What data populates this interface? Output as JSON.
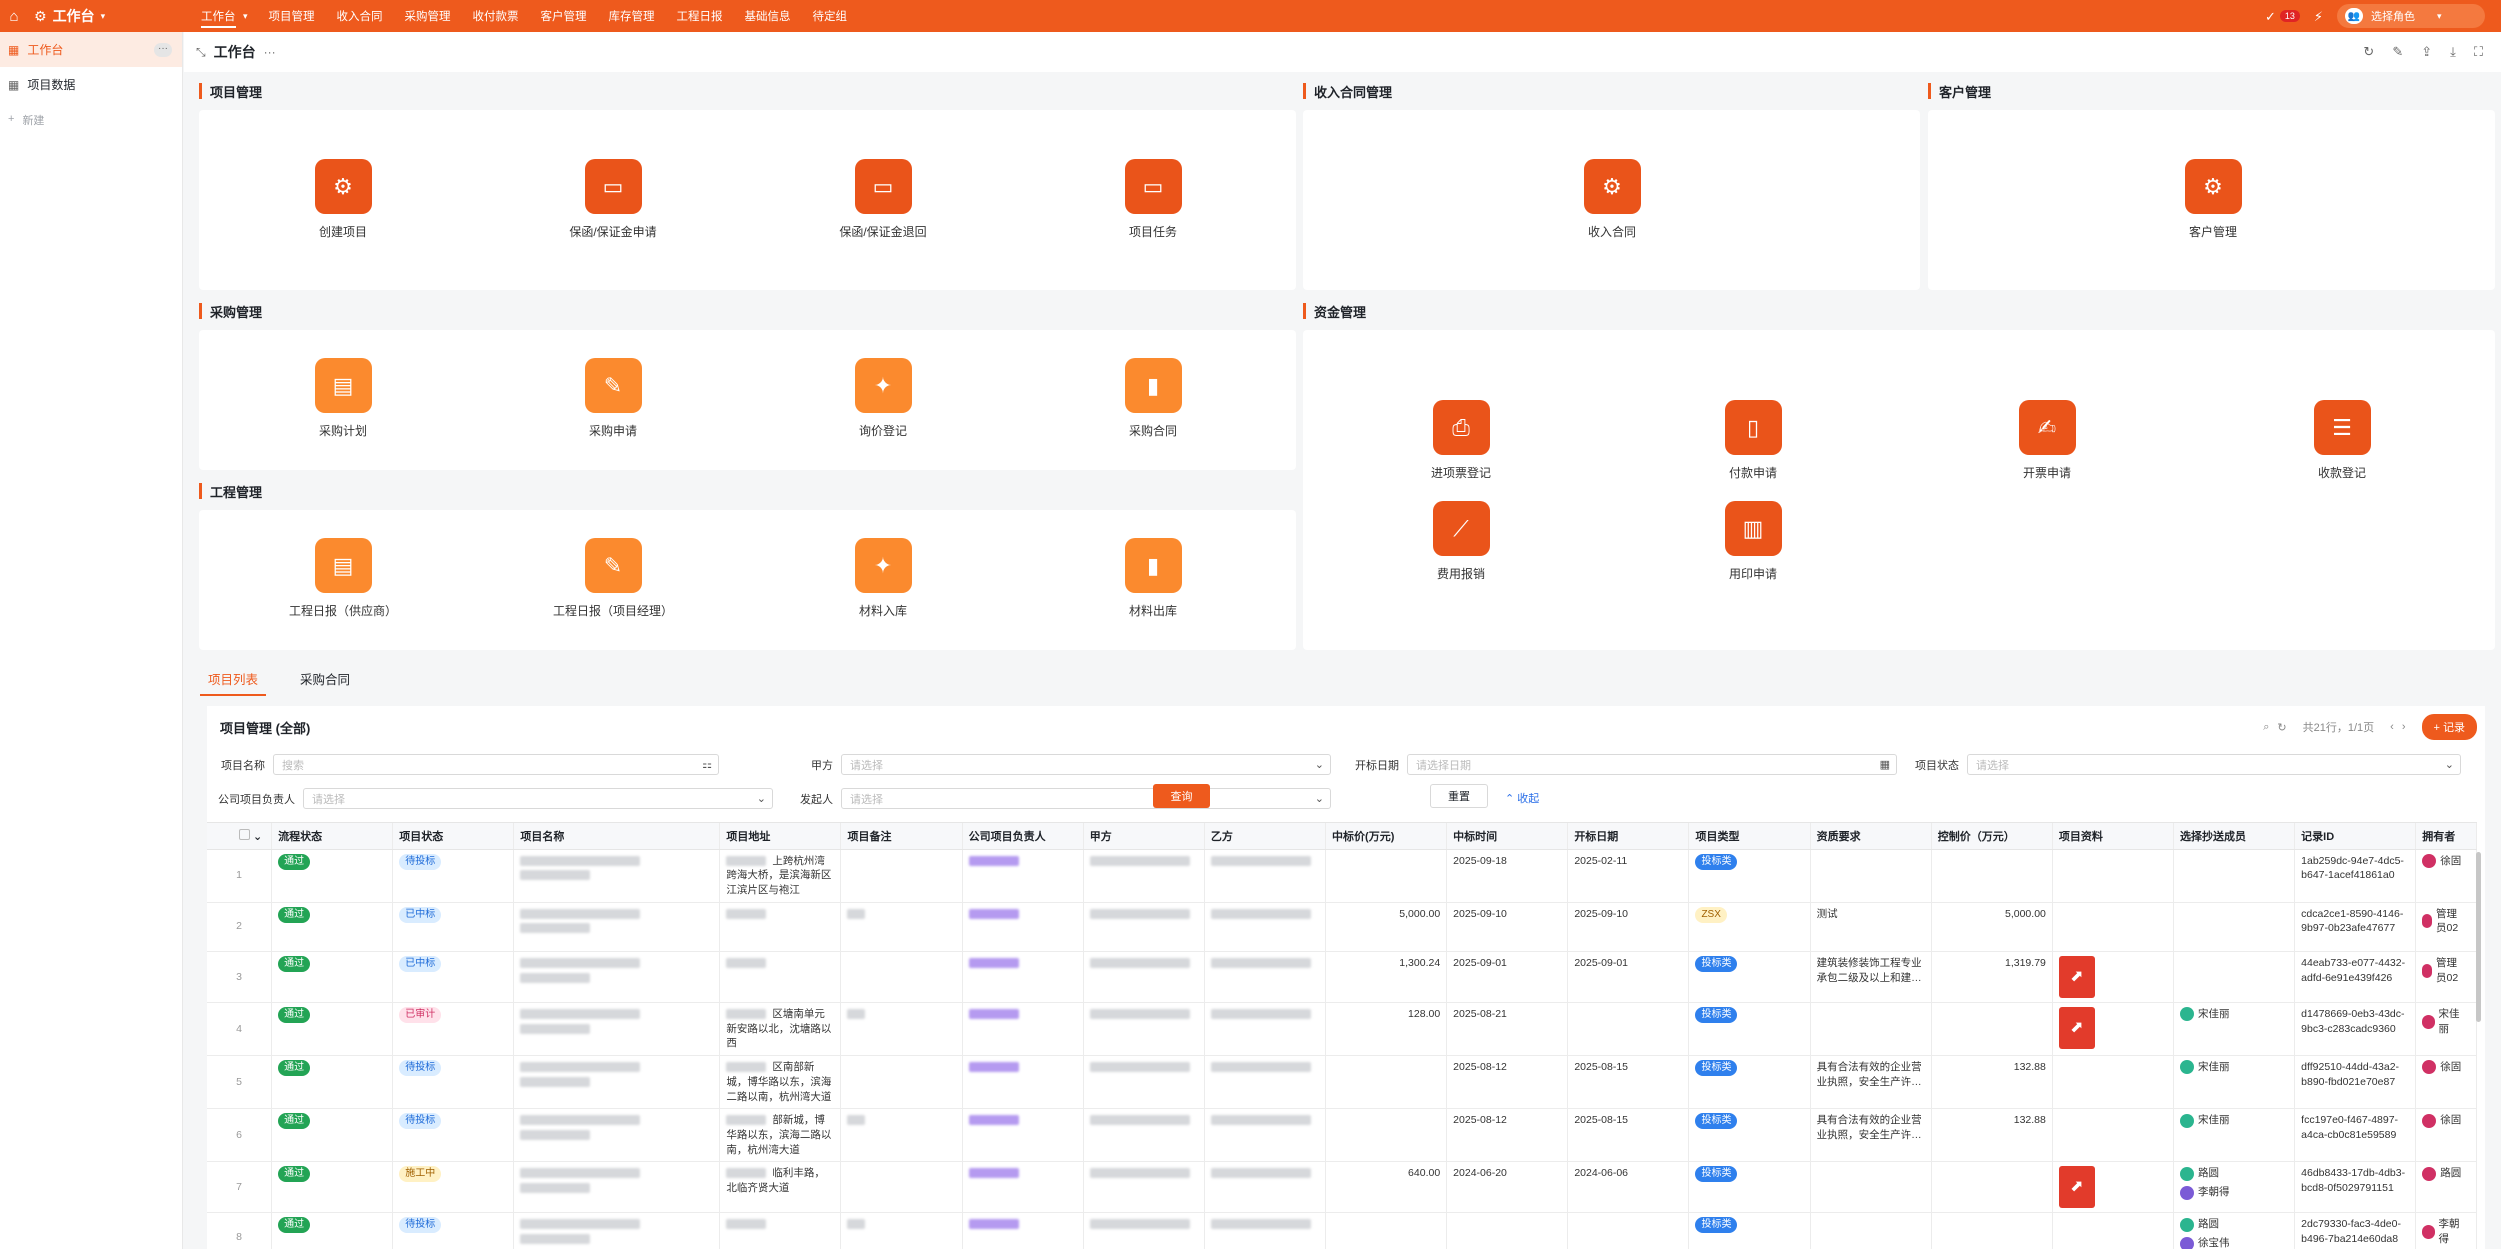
{
  "topnav": {
    "app_title": "工作台",
    "menu": [
      "工作台",
      "项目管理",
      "收入合同",
      "采购管理",
      "收付款票",
      "客户管理",
      "库存管理",
      "工程日报",
      "基础信息",
      "待定组"
    ],
    "notification_count": "13",
    "role_label": "选择角色"
  },
  "sidebar": {
    "items": [
      {
        "label": "工作台"
      },
      {
        "label": "项目数据"
      }
    ],
    "new_label": "新建"
  },
  "page": {
    "title": "工作台"
  },
  "sections": {
    "project": {
      "title": "项目管理",
      "tiles": [
        "创建项目",
        "保函/保证金申请",
        "保函/保证金退回",
        "项目任务"
      ]
    },
    "income": {
      "title": "收入合同管理",
      "tiles": [
        "收入合同"
      ]
    },
    "customer": {
      "title": "客户管理",
      "tiles": [
        "客户管理"
      ]
    },
    "purchase": {
      "title": "采购管理",
      "tiles": [
        "采购计划",
        "采购申请",
        "询价登记",
        "采购合同"
      ]
    },
    "engineering": {
      "title": "工程管理",
      "tiles": [
        "工程日报（供应商）",
        "工程日报（项目经理）",
        "材料入库",
        "材料出库"
      ]
    },
    "funds": {
      "title": "资金管理",
      "tiles": [
        "进项票登记",
        "付款申请",
        "开票申请",
        "收款登记",
        "费用报销",
        "用印申请"
      ]
    }
  },
  "tabs": [
    "项目列表",
    "采购合同"
  ],
  "panel": {
    "title": "项目管理 (全部)",
    "record_info": "共21行，1/1页",
    "add_label": "+ 记录",
    "filters": {
      "name_label": "项目名称",
      "name_placeholder": "搜索",
      "party_a_label": "甲方",
      "party_a_placeholder": "请选择",
      "bid_date_label": "开标日期",
      "bid_date_placeholder": "请选择日期",
      "status_label": "项目状态",
      "status_placeholder": "请选择",
      "owner_label": "公司项目负责人",
      "owner_placeholder": "请选择",
      "initiator_label": "发起人",
      "initiator_placeholder": "请选择"
    },
    "query_label": "查询",
    "reset_label": "重置",
    "collapse_label": "收起"
  },
  "table": {
    "columns": [
      "流程状态",
      "项目状态",
      "项目名称",
      "项目地址",
      "项目备注",
      "公司项目负责人",
      "甲方",
      "乙方",
      "中标价(万元)",
      "中标时间",
      "开标日期",
      "项目类型",
      "资质要求",
      "控制价（万元）",
      "项目资料",
      "选择抄送成员",
      "记录ID",
      "拥有者"
    ],
    "rows": [
      {
        "idx": "1",
        "flow": "通过",
        "status": "待投标",
        "status_color": "blue",
        "address": "上跨杭州湾跨海大桥，是滨海新区江滨片区与袍江",
        "price": "",
        "win_date": "2025-09-18",
        "bid_date": "2025-02-11",
        "type": "投标类",
        "type_color": "bluefill",
        "qual": "",
        "control": "",
        "pdf": false,
        "cc": [],
        "id": "1ab259dc-94e7-4dc5-b647-1acef41861a0",
        "owner": "徐固"
      },
      {
        "idx": "2",
        "flow": "通过",
        "status": "已中标",
        "status_color": "blue",
        "address": "",
        "price": "5,000.00",
        "win_date": "2025-09-10",
        "bid_date": "2025-09-10",
        "type": "ZSX",
        "type_color": "yellow",
        "qual": "测试",
        "control": "5,000.00",
        "pdf": false,
        "cc": [],
        "id": "cdca2ce1-8590-4146-9b97-0b23afe47677",
        "owner": "管理员02"
      },
      {
        "idx": "3",
        "flow": "通过",
        "status": "已中标",
        "status_color": "blue",
        "address": "",
        "price": "1,300.24",
        "win_date": "2025-09-01",
        "bid_date": "2025-09-01",
        "type": "投标类",
        "type_color": "bluefill",
        "qual": "建筑装修装饰工程专业承包二级及以上和建…",
        "control": "1,319.79",
        "pdf": true,
        "cc": [],
        "id": "44eab733-e077-4432-adfd-6e91e439f426",
        "owner": "管理员02"
      },
      {
        "idx": "4",
        "flow": "通过",
        "status": "已审计",
        "status_color": "pink",
        "address": "区塘南单元新安路以北，沈塘路以西",
        "price": "128.00",
        "win_date": "2025-08-21",
        "bid_date": "",
        "type": "投标类",
        "type_color": "bluefill",
        "qual": "",
        "control": "",
        "pdf": true,
        "cc": [
          "宋佳丽"
        ],
        "id": "d1478669-0eb3-43dc-9bc3-c283cadc9360",
        "owner": "宋佳丽"
      },
      {
        "idx": "5",
        "flow": "通过",
        "status": "待投标",
        "status_color": "blue",
        "address": "区南部新城，博华路以东，滨海二路以南，杭州湾大道",
        "price": "",
        "win_date": "2025-08-12",
        "bid_date": "2025-08-15",
        "type": "投标类",
        "type_color": "bluefill",
        "qual": "具有合法有效的企业营业执照，安全生产许…",
        "control": "132.88",
        "pdf": false,
        "cc": [
          "宋佳丽"
        ],
        "id": "dff92510-44dd-43a2-b890-fbd021e70e87",
        "owner": "徐固"
      },
      {
        "idx": "6",
        "flow": "通过",
        "status": "待投标",
        "status_color": "blue",
        "address": "部新城，博华路以东，滨海二路以南，杭州湾大道",
        "price": "",
        "win_date": "2025-08-12",
        "bid_date": "2025-08-15",
        "type": "投标类",
        "type_color": "bluefill",
        "qual": "具有合法有效的企业营业执照，安全生产许…",
        "control": "132.88",
        "pdf": false,
        "cc": [
          "宋佳丽"
        ],
        "id": "fcc197e0-f467-4897-a4ca-cb0c81e59589",
        "owner": "徐固"
      },
      {
        "idx": "7",
        "flow": "通过",
        "status": "施工中",
        "status_color": "yellow",
        "address": "临利丰路，北临齐贤大道",
        "price": "640.00",
        "win_date": "2024-06-20",
        "bid_date": "2024-06-06",
        "type": "投标类",
        "type_color": "bluefill",
        "qual": "",
        "control": "",
        "pdf": true,
        "cc": [
          "路圆",
          "李朝得"
        ],
        "id": "46db8433-17db-4db3-bcd8-0f5029791151",
        "owner": "路圆"
      },
      {
        "idx": "8",
        "flow": "通过",
        "status": "待投标",
        "status_color": "blue",
        "address": "",
        "price": "",
        "win_date": "",
        "bid_date": "",
        "type": "投标类",
        "type_color": "bluefill",
        "qual": "",
        "control": "",
        "pdf": false,
        "cc": [
          "路圆",
          "徐宝伟"
        ],
        "id": "2dc79330-fac3-4de0-b496-7ba214e60da8",
        "owner": "李朝得"
      }
    ]
  }
}
